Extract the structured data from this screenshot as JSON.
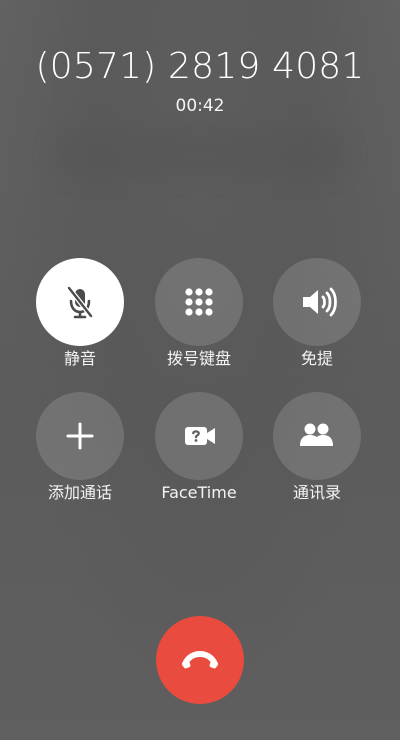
{
  "call": {
    "phone_number": "(0571) 2819 4081",
    "timer": "00:42"
  },
  "controls": [
    {
      "label": "静音",
      "icon": "mute-icon",
      "active": true
    },
    {
      "label": "拨号键盘",
      "icon": "keypad-icon",
      "active": false
    },
    {
      "label": "免提",
      "icon": "speaker-icon",
      "active": false
    },
    {
      "label": "添加通话",
      "icon": "add-call-icon",
      "active": false
    },
    {
      "label": "FaceTime",
      "icon": "facetime-icon",
      "active": false
    },
    {
      "label": "通讯录",
      "icon": "contacts-icon",
      "active": false
    }
  ],
  "end_call": {
    "icon": "end-call-icon",
    "color": "#ea4b3f"
  },
  "colors": {
    "background": "#5f5f5f",
    "button_fill": "rgba(255,255,255,0.14)",
    "active_button_fill": "#ffffff"
  }
}
